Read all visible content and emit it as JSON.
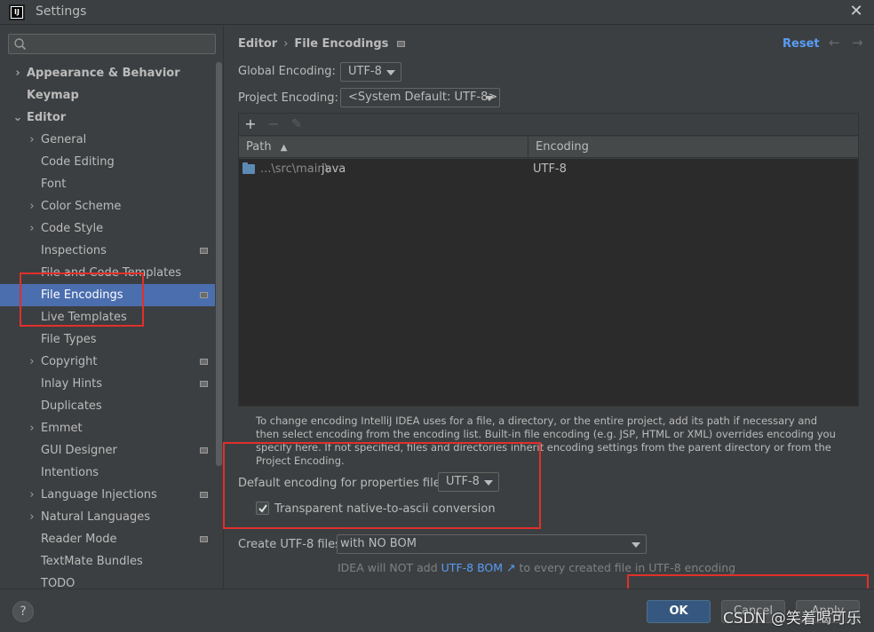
{
  "window": {
    "title": "Settings",
    "app_icon": "IJ"
  },
  "search": {
    "placeholder": ""
  },
  "sidebar": {
    "items": [
      {
        "label": "Appearance & Behavior"
      },
      {
        "label": "Keymap"
      },
      {
        "label": "Editor"
      },
      {
        "label": "General"
      },
      {
        "label": "Code Editing"
      },
      {
        "label": "Font"
      },
      {
        "label": "Color Scheme"
      },
      {
        "label": "Code Style"
      },
      {
        "label": "Inspections"
      },
      {
        "label": "File and Code Templates"
      },
      {
        "label": "File Encodings"
      },
      {
        "label": "Live Templates"
      },
      {
        "label": "File Types"
      },
      {
        "label": "Copyright"
      },
      {
        "label": "Inlay Hints"
      },
      {
        "label": "Duplicates"
      },
      {
        "label": "Emmet"
      },
      {
        "label": "GUI Designer"
      },
      {
        "label": "Intentions"
      },
      {
        "label": "Language Injections"
      },
      {
        "label": "Natural Languages"
      },
      {
        "label": "Reader Mode"
      },
      {
        "label": "TextMate Bundles"
      },
      {
        "label": "TODO"
      }
    ]
  },
  "header": {
    "crumb_parent": "Editor",
    "crumb_sep": "›",
    "crumb_current": "File Encodings",
    "reset": "Reset",
    "back": "←",
    "forward": "→"
  },
  "form": {
    "global_label": "Global Encoding:",
    "global_value": "UTF-8",
    "project_label": "Project Encoding:",
    "project_value": "<System Default: UTF-8>"
  },
  "table": {
    "add": "+",
    "remove": "−",
    "edit": "✎",
    "col_path": "Path",
    "col_encoding": "Encoding",
    "rows": [
      {
        "path_prefix": "...\\src\\main\\",
        "path_name": "java",
        "encoding": "UTF-8"
      }
    ]
  },
  "help": {
    "text": "To change encoding IntelliJ IDEA uses for a file, a directory, or the entire project, add its path if necessary and then select encoding from the encoding list. Built-in file encoding (e.g. JSP, HTML or XML) overrides encoding you specify here. If not specified, files and directories inherit encoding settings from the parent directory or from the Project Encoding."
  },
  "properties": {
    "label": "Default encoding for properties files:",
    "value": "UTF-8",
    "transparent_label": "Transparent native-to-ascii conversion",
    "transparent_checked": true
  },
  "bom": {
    "label": "Create UTF-8 files:",
    "value": "with NO BOM",
    "hint_before": "IDEA will NOT add ",
    "hint_link": "UTF-8 BOM ↗",
    "hint_after": " to every created file in UTF-8 encoding"
  },
  "footer": {
    "help": "?",
    "ok": "OK",
    "cancel": "Cancel",
    "apply": "Apply"
  },
  "watermark": "CSDN @笑着喝可乐",
  "colors": {
    "selection": "#4b6eaf",
    "link": "#589df6",
    "annotation": "#e0302b",
    "ok_button": "#365880"
  }
}
